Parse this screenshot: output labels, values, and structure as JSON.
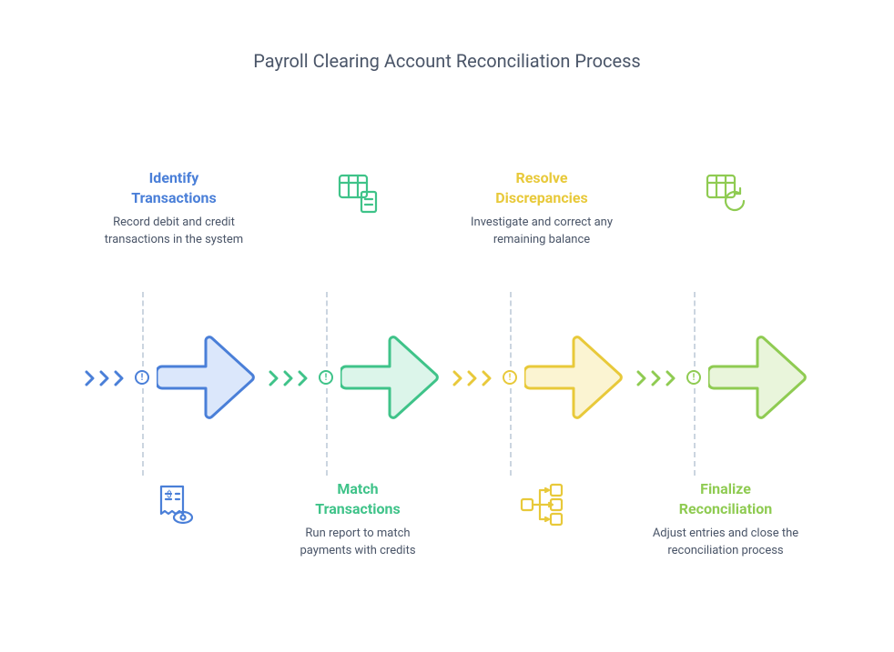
{
  "title": "Payroll Clearing Account Reconciliation Process",
  "steps": [
    {
      "title": "Identify\nTransactions",
      "desc": "Record debit and credit transactions in the system",
      "position": "top",
      "theme_class": "c-blue",
      "stroke_class": "blue-stroke",
      "fill_class": "blue-fill",
      "icon": "receipt-view-icon"
    },
    {
      "title": "Match\nTransactions",
      "desc": "Run report to match payments with credits",
      "position": "bottom",
      "theme_class": "c-green",
      "stroke_class": "green-stroke",
      "fill_class": "green-fill",
      "icon": "table-file-icon"
    },
    {
      "title": "Resolve\nDiscrepancies",
      "desc": "Investigate and correct any remaining balance",
      "position": "top",
      "theme_class": "c-yellow",
      "stroke_class": "yellow-stroke",
      "fill_class": "yellow-fill",
      "icon": "branch-icon"
    },
    {
      "title": "Finalize\nReconciliation",
      "desc": "Adjust entries and close the reconciliation process",
      "position": "bottom",
      "theme_class": "c-lime",
      "stroke_class": "lime-stroke",
      "fill_class": "lime-fill",
      "icon": "table-refresh-icon"
    }
  ]
}
